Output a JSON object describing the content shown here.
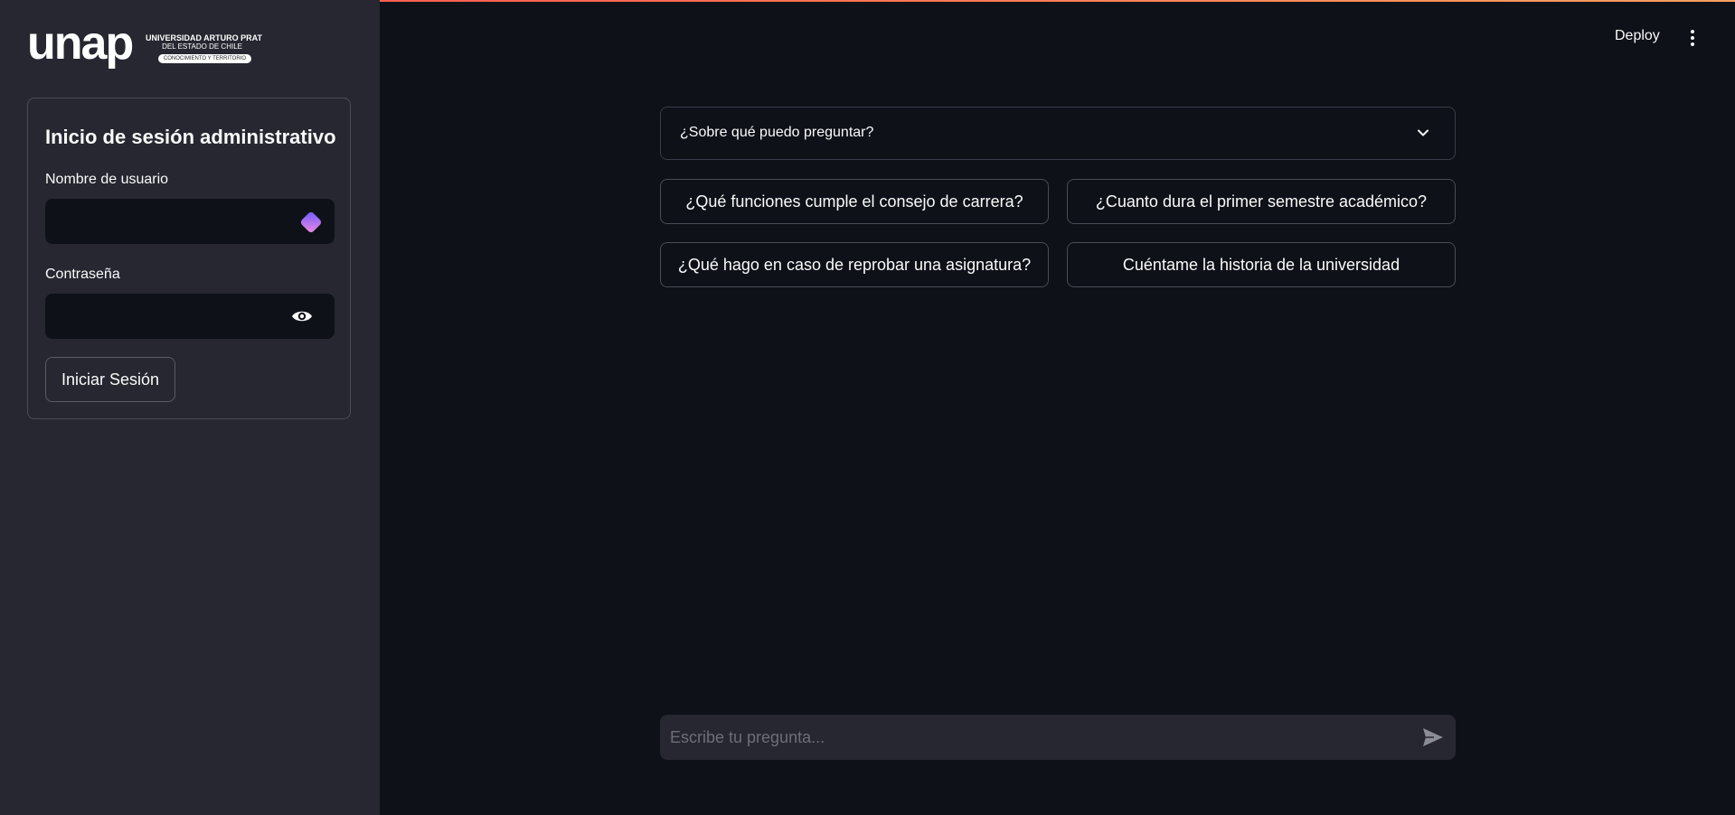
{
  "sidebar": {
    "logo": {
      "word": "unap",
      "line1": "UNIVERSIDAD ARTURO PRAT",
      "line2": "DEL ESTADO DE CHILE",
      "line3": "CONOCIMIENTO Y TERRITORIO"
    },
    "login": {
      "title": "Inicio de sesión administrativo",
      "username_label": "Nombre de usuario",
      "username_value": "",
      "password_label": "Contraseña",
      "password_value": "",
      "submit_label": "Iniciar Sesión",
      "password_manager_icon": "password-manager-icon",
      "show_password_icon": "eye-icon"
    }
  },
  "header": {
    "deploy_label": "Deploy",
    "menu_icon": "vertical-dots-icon"
  },
  "main": {
    "expander": {
      "label": "¿Sobre qué puedo preguntar?",
      "icon": "chevron-down-icon"
    },
    "suggestions": [
      "¿Qué funciones cumple el consejo de carrera?",
      "¿Cuanto dura el primer semestre académico?",
      "¿Qué hago en caso de reprobar una asignatura?",
      "Cuéntame la historia de la universidad"
    ],
    "chat_input": {
      "placeholder": "Escribe tu pregunta...",
      "send_icon": "send-icon"
    }
  },
  "colors": {
    "background": "#0e1118",
    "sidebar": "#262730",
    "text": "#fafafa",
    "border": "#4a4c57",
    "accent_gradient_start": "#ff4b4b"
  }
}
